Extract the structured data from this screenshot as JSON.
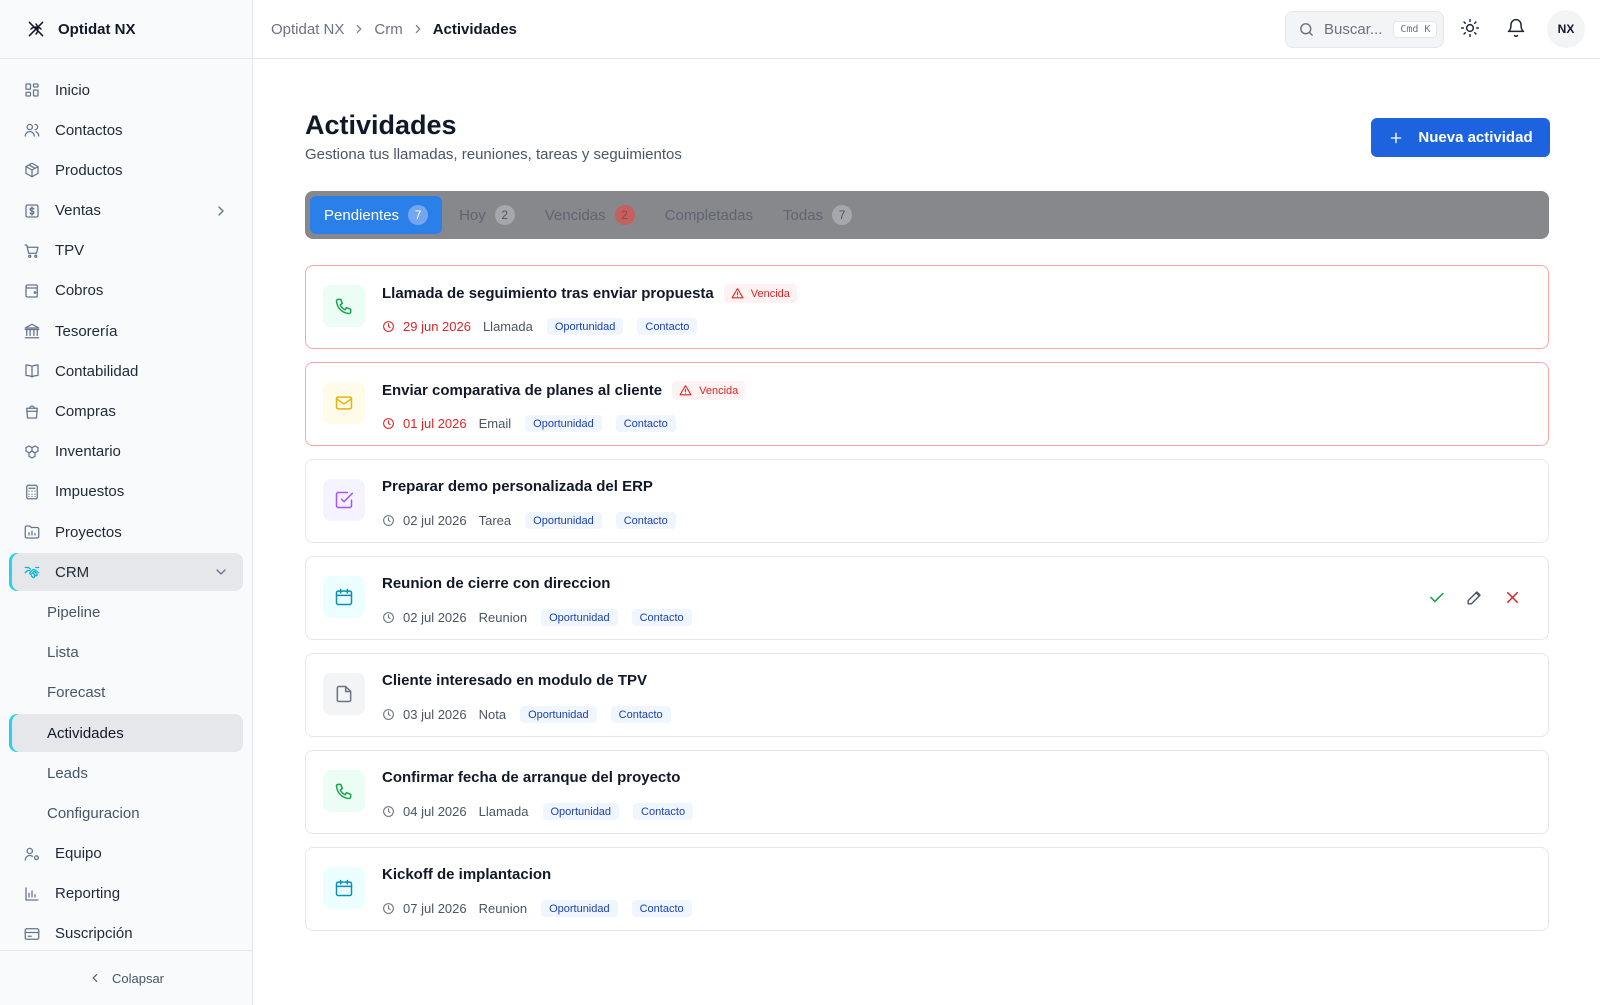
{
  "app": {
    "name": "Optidat NX"
  },
  "sidebar": {
    "items": [
      {
        "label": "Inicio",
        "icon": "dashboard-icon"
      },
      {
        "label": "Contactos",
        "icon": "users-icon"
      },
      {
        "label": "Productos",
        "icon": "package-icon"
      },
      {
        "label": "Ventas",
        "icon": "dollar-icon",
        "has_chevron": true
      },
      {
        "label": "TPV",
        "icon": "cart-icon"
      },
      {
        "label": "Cobros",
        "icon": "wallet-icon"
      },
      {
        "label": "Tesorería",
        "icon": "bank-icon"
      },
      {
        "label": "Contabilidad",
        "icon": "book-icon"
      },
      {
        "label": "Compras",
        "icon": "bag-icon"
      },
      {
        "label": "Inventario",
        "icon": "boxes-icon"
      },
      {
        "label": "Impuestos",
        "icon": "calculator-icon"
      },
      {
        "label": "Proyectos",
        "icon": "folder-chart-icon"
      },
      {
        "label": "CRM",
        "icon": "handshake-icon",
        "active": true,
        "expanded": true
      }
    ],
    "crm_sub": [
      {
        "label": "Pipeline"
      },
      {
        "label": "Lista"
      },
      {
        "label": "Forecast"
      },
      {
        "label": "Actividades",
        "active": true
      },
      {
        "label": "Leads"
      },
      {
        "label": "Configuracion"
      }
    ],
    "bottom_items": [
      {
        "label": "Equipo",
        "icon": "user-cog-icon"
      },
      {
        "label": "Reporting",
        "icon": "bar-chart-icon"
      },
      {
        "label": "Suscripción",
        "icon": "credit-card-icon"
      }
    ],
    "collapse_label": "Colapsar"
  },
  "topbar": {
    "breadcrumb": [
      "Optidat NX",
      "Crm",
      "Actividades"
    ],
    "search_placeholder": "Buscar...",
    "kbd": [
      "Cmd",
      "K"
    ],
    "avatar": "NX"
  },
  "page": {
    "title": "Actividades",
    "subtitle": "Gestiona tus llamadas, reuniones, tareas y seguimientos",
    "new_button": "Nueva actividad"
  },
  "tabs": [
    {
      "label": "Pendientes",
      "count": "7",
      "active": true
    },
    {
      "label": "Hoy",
      "count": "2"
    },
    {
      "label": "Vencidas",
      "count": "2",
      "red": true
    },
    {
      "label": "Completadas",
      "count": ""
    },
    {
      "label": "Todas",
      "count": "7"
    }
  ],
  "activities": [
    {
      "title": "Llamada de seguimiento tras enviar propuesta",
      "overdue": true,
      "overdue_label": "Vencida",
      "date": "29 jun 2026",
      "type": "Llamada",
      "kind": "call",
      "tags": [
        "Oportunidad",
        "Contacto"
      ]
    },
    {
      "title": "Enviar comparativa de planes al cliente",
      "overdue": true,
      "overdue_label": "Vencida",
      "date": "01 jul 2026",
      "type": "Email",
      "kind": "email",
      "tags": [
        "Oportunidad",
        "Contacto"
      ]
    },
    {
      "title": "Preparar demo personalizada del ERP",
      "overdue": false,
      "date": "02 jul 2026",
      "type": "Tarea",
      "kind": "task",
      "tags": [
        "Oportunidad",
        "Contacto"
      ]
    },
    {
      "title": "Reunion de cierre con direccion",
      "overdue": false,
      "date": "02 jul 2026",
      "type": "Reunion",
      "kind": "meet",
      "tags": [
        "Oportunidad",
        "Contacto"
      ],
      "show_actions": true
    },
    {
      "title": "Cliente interesado en modulo de TPV",
      "overdue": false,
      "date": "03 jul 2026",
      "type": "Nota",
      "kind": "note",
      "tags": [
        "Oportunidad",
        "Contacto"
      ]
    },
    {
      "title": "Confirmar fecha de arranque del proyecto",
      "overdue": false,
      "date": "04 jul 2026",
      "type": "Llamada",
      "kind": "call",
      "tags": [
        "Oportunidad",
        "Contacto"
      ]
    },
    {
      "title": "Kickoff de implantacion",
      "overdue": false,
      "date": "07 jul 2026",
      "type": "Reunion",
      "kind": "meet",
      "tags": [
        "Oportunidad",
        "Contacto"
      ]
    }
  ],
  "colors": {
    "primary": "#1d63e0",
    "accent": "#22d3ee",
    "danger": "#dc2626",
    "success": "#16a34a"
  }
}
